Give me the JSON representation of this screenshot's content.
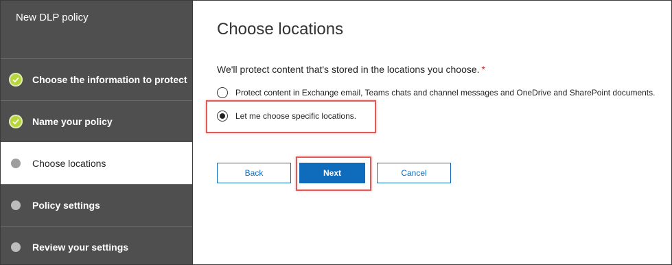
{
  "sidebar": {
    "title": "New DLP policy",
    "steps": [
      {
        "label": "Choose the information to protect",
        "status": "done"
      },
      {
        "label": "Name your policy",
        "status": "done"
      },
      {
        "label": "Choose locations",
        "status": "current"
      },
      {
        "label": "Policy settings",
        "status": "pending"
      },
      {
        "label": "Review your settings",
        "status": "pending"
      }
    ]
  },
  "main": {
    "title": "Choose locations",
    "prompt": "We'll protect content that's stored in the locations you choose.",
    "required_marker": "*",
    "options": [
      {
        "label": "Protect content in Exchange email, Teams chats and channel messages and OneDrive and SharePoint documents.",
        "selected": false
      },
      {
        "label": "Let me choose specific locations.",
        "selected": true
      }
    ],
    "buttons": {
      "back": "Back",
      "next": "Next",
      "cancel": "Cancel"
    }
  },
  "colors": {
    "sidebar_bg": "#4f4f4f",
    "accent": "#0f6cbd",
    "done_check": "#b6d63a",
    "highlight": "#e05a5a",
    "required": "#c4262e"
  }
}
